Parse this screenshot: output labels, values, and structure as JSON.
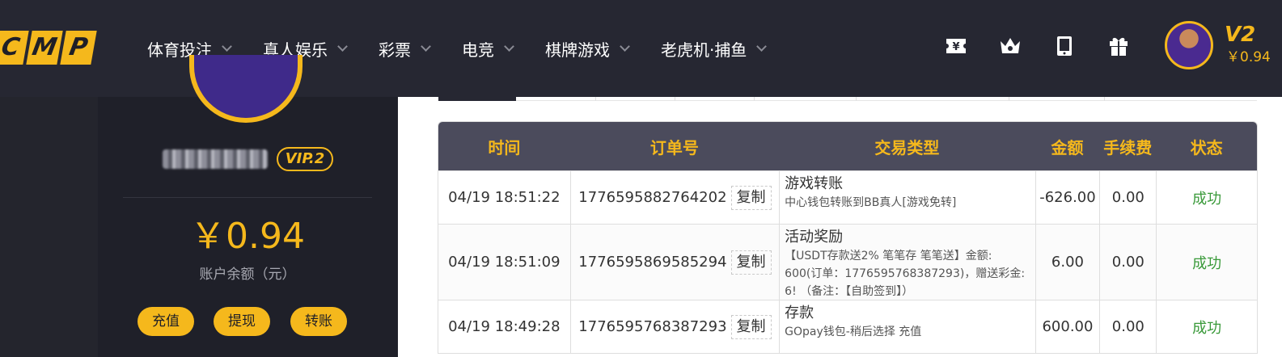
{
  "brand": {
    "logo_letters": [
      "C",
      "M",
      "P"
    ]
  },
  "nav": {
    "items": [
      {
        "label": "体育投注"
      },
      {
        "label": "真人娱乐"
      },
      {
        "label": "彩票"
      },
      {
        "label": "电竞"
      },
      {
        "label": "棋牌游戏"
      },
      {
        "label": "老虎机·捕鱼"
      }
    ]
  },
  "header": {
    "icons": [
      "ticket-icon",
      "crown-icon",
      "tablet-icon",
      "gift-icon"
    ],
    "vip_level": "V2",
    "balance": "￥0.94"
  },
  "profile": {
    "vip_badge": "VIP.2",
    "balance": "￥0.94",
    "balance_label": "账户余额（元）",
    "buttons": {
      "deposit": "充值",
      "withdraw": "提现",
      "transfer": "转账"
    }
  },
  "table": {
    "headers": [
      "时间",
      "订单号",
      "交易类型",
      "金额",
      "手续费",
      "状态"
    ],
    "copy_label": "复制",
    "rows": [
      {
        "time": "04/19 18:51:22",
        "order": "1776595882764202",
        "type_title": "游戏转账",
        "type_desc": "中心钱包转账到BB真人[游戏免转]",
        "amount": "-626.00",
        "fee": "0.00",
        "status": "成功"
      },
      {
        "time": "04/19 18:51:09",
        "order": "1776595869585294",
        "type_title": "活动奖励",
        "type_desc": "【USDT存款送2% 笔笔存 笔笔送】金额: 600(订单：1776595768387293)，赠送彩金: 6! （备注：【自助签到】）",
        "amount": "6.00",
        "fee": "0.00",
        "status": "成功"
      },
      {
        "time": "04/19 18:49:28",
        "order": "1776595768387293",
        "type_title": "存款",
        "type_desc": "GOpay钱包-稍后选择 充值",
        "amount": "600.00",
        "fee": "0.00",
        "status": "成功"
      }
    ]
  },
  "colors": {
    "accent": "#f5b81c",
    "topbar": "#262732",
    "table_header": "#4b4b5c",
    "success": "#3a9a3a"
  }
}
